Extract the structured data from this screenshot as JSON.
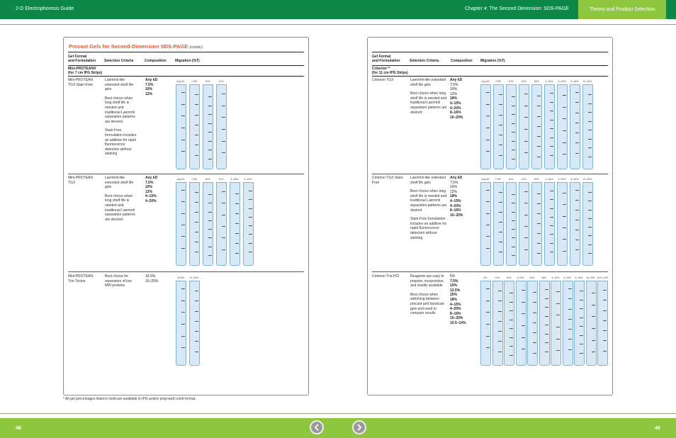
{
  "header": {
    "guide_title": "2-D Electrophoresis Guide",
    "chapter_title": "Chapter 4: The Second Dimension: SDS-PAGE",
    "section_tab": "Theory and Product Selection"
  },
  "left_panel": {
    "title": "Precast Gels for Second-Dimension SDS-PAGE",
    "title_suffix": "(contd.)",
    "col_gel_format_1": "Gel Format",
    "col_gel_format_2": "and Formulation",
    "col_selection": "Selection Criteria",
    "col_composition": "Composition",
    "col_migration": "Migration (%T)",
    "subheader_1": "Mini-PROTEAN®",
    "subheader_2": "(for 7 cm IPG Strips)",
    "rows": [
      {
        "format": "Mini-PROTEAN TGX Stain-Free",
        "criteria": [
          "Laemmli-like extended shelf life gels",
          "Best choice when long shelf life is needed and traditional Laemmli separation patterns are desired",
          "Stain-Free formulation includes an additive for rapid fluorescence detection without staining"
        ],
        "composition": [
          "Any kD",
          "7.5%",
          "10%",
          "12%"
        ],
        "lanes": [
          "Any kD",
          "7.5%",
          "10%",
          "12%"
        ]
      },
      {
        "format": "Mini-PROTEAN TGX",
        "criteria": [
          "Laemmli-like extended shelf life gels",
          "Best choice when long shelf life is needed and traditional Laemmli separation patterns are desired"
        ],
        "composition": [
          "Any kD",
          "7.5%",
          "10%",
          "12%",
          "4–15%",
          "4–20%"
        ],
        "lanes": [
          "Any kD",
          "7.5%",
          "10%",
          "12%",
          "4–15%",
          "4–20%"
        ]
      },
      {
        "format": "Mini-PROTEAN Tris-Tricine",
        "criteria": [
          "Best choice for separation of low MW proteins"
        ],
        "composition": [
          "16.5%",
          "10–20%"
        ],
        "lanes": [
          "16.5%",
          "10–20%"
        ]
      }
    ]
  },
  "right_panel": {
    "col_gel_format_1": "Gel Format",
    "col_gel_format_2": "and Formulation",
    "col_selection": "Selection Criteria",
    "col_composition": "Composition",
    "col_migration": "Migration (%T)",
    "subheader_1": "Criterion™",
    "subheader_2": "(for 11 cm IPG Strips)",
    "rows": [
      {
        "format": "Criterion TGX",
        "criteria": [
          "Laemmli-like extended shelf life gels",
          "Best choice when long shelf life is needed and traditional Laemmli separation patterns are desired"
        ],
        "composition": [
          "Any kD",
          "7.5%",
          "10%",
          "12%",
          "18%",
          "4–15%",
          "4–20%",
          "8–16%",
          "10–20%"
        ],
        "lanes": [
          "Any kD",
          "7.5%",
          "10%",
          "12%",
          "18%",
          "4–15%",
          "4–20%",
          "8–16%",
          "10–20%"
        ]
      },
      {
        "format": "Criterion TGX Stain-Free",
        "criteria": [
          "Laemmli-like extended shelf life gels",
          "Best choice when long shelf life is needed and traditional Laemmli separation patterns are desired",
          "Stain-Free formulation includes an additive for rapid fluorescence detection without staining"
        ],
        "composition": [
          "Any kD",
          "7.5%",
          "10%",
          "12%",
          "18%",
          "4–15%",
          "4–20%",
          "8–16%",
          "10–20%"
        ],
        "lanes": [
          "Any kD",
          "7.5%",
          "10%",
          "12%",
          "18%",
          "4–15%",
          "4–20%",
          "8–16%",
          "10–20%"
        ]
      },
      {
        "format": "Criterion Tris-HCl",
        "criteria": [
          "Reagents are easy to prepare, inexpensive, and readily available",
          "Best choice when switching between precast and handcast gels and need to compare results"
        ],
        "composition": [
          "5%",
          "7.5%",
          "10%",
          "12.5%",
          "15%",
          "18%",
          "4–15%",
          "4–20%",
          "8–16%",
          "10–20%",
          "10.5–14%"
        ],
        "lanes": [
          "5%",
          "7.5%",
          "10%",
          "12.5%",
          "15%",
          "18%",
          "4–15%",
          "4–20%",
          "8–16%",
          "10–20%",
          "10.5–14%"
        ]
      }
    ]
  },
  "footnote": "* All gel percentages listed in bold are available in IPG and/or prep-well comb format.",
  "footer": {
    "left_page": "48",
    "right_page": "49",
    "prev_icon": "chevron-left-icon",
    "next_icon": "chevron-right-icon"
  },
  "colors": {
    "green_dark": "#0d8747",
    "green_light": "#8fc640",
    "title_orange": "#e4572e",
    "lane_blue": "#d8e9f5"
  }
}
